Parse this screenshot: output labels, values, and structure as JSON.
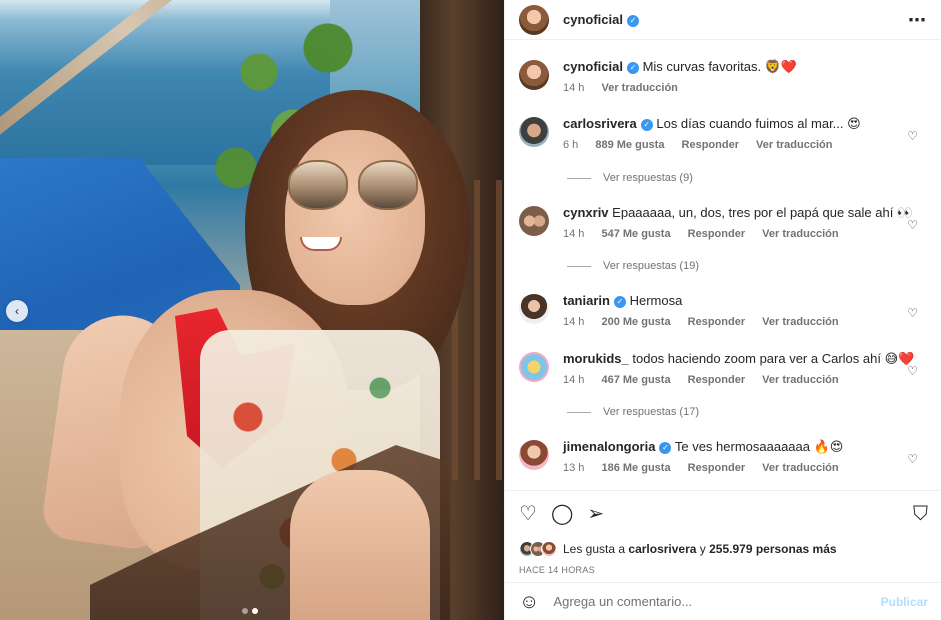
{
  "post": {
    "author": "cynoficial",
    "more_icon": "⋯",
    "caption": "Mis curvas favoritas. 🦁❤️",
    "caption_time": "14 h",
    "caption_translate": "Ver traducción",
    "carousel_prev_icon": "‹"
  },
  "comments": [
    {
      "user": "carlosrivera",
      "verified": true,
      "text": "Los días cuando fuimos al mar... 😍",
      "time": "6 h",
      "likes": "889 Me gusta",
      "reply": "Responder",
      "translate": "Ver traducción",
      "replies": "Ver respuestas (9)"
    },
    {
      "user": "cynxriv",
      "verified": false,
      "text": "Epaaaaaa, un, dos, tres por el papá que sale ahí 👀",
      "time": "14 h",
      "likes": "547 Me gusta",
      "reply": "Responder",
      "translate": "Ver traducción",
      "replies": "Ver respuestas (19)"
    },
    {
      "user": "taniarin",
      "verified": true,
      "text": "Hermosa",
      "time": "14 h",
      "likes": "200 Me gusta",
      "reply": "Responder",
      "translate": "Ver traducción"
    },
    {
      "user": "morukids_",
      "verified": false,
      "text": "todos haciendo zoom para ver a Carlos ahí 😅❤️",
      "time": "14 h",
      "likes": "467 Me gusta",
      "reply": "Responder",
      "translate": "Ver traducción",
      "replies": "Ver respuestas (17)"
    },
    {
      "user": "jimenalongoria",
      "verified": true,
      "text": "Te ves hermosaaaaaaa 🔥😍",
      "time": "13 h",
      "likes": "186 Me gusta",
      "reply": "Responder",
      "translate": "Ver traducción"
    }
  ],
  "actions": {
    "like_icon": "♡",
    "comment_icon": "◯",
    "share_icon": "➢",
    "save_icon": "⛉"
  },
  "likes": {
    "prefix": "Les gusta a ",
    "user": "carlosrivera",
    "middle": " y ",
    "count": "255.979 personas más"
  },
  "time_ago": "HACE 14 HORAS",
  "add_comment": {
    "smiley_icon": "☺",
    "placeholder": "Agrega un comentario...",
    "publish": "Publicar"
  },
  "colors": {
    "verified": "#3897f0",
    "muted": "#737373",
    "publish_disabled": "#b2dffc"
  }
}
